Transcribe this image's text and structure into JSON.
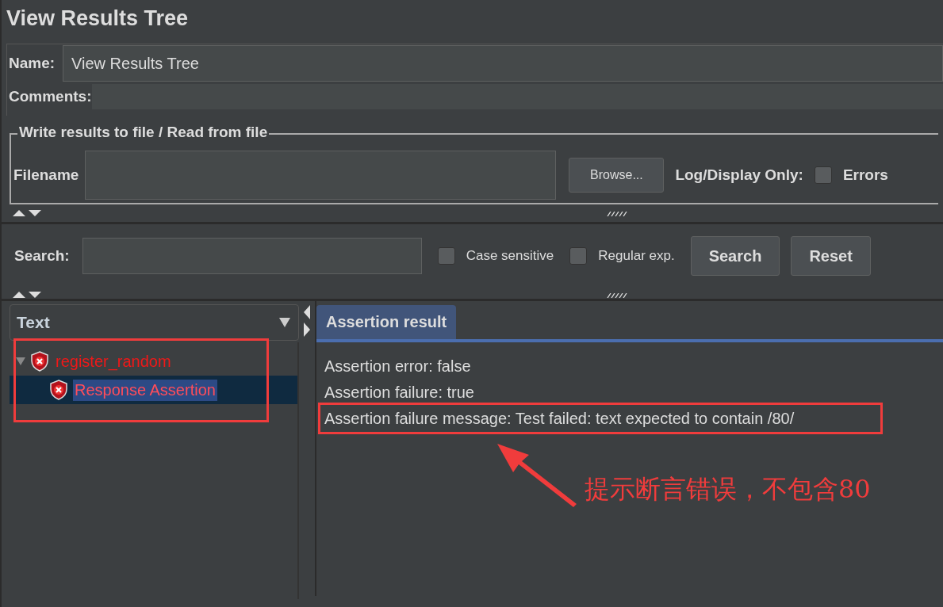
{
  "window": {
    "title": "View Results Tree"
  },
  "name": {
    "label": "Name:",
    "value": "View Results Tree"
  },
  "comments": {
    "label": "Comments:"
  },
  "file_section": {
    "title": "Write results to file / Read from file",
    "filename_label": "Filename",
    "browse_button": "Browse...",
    "log_label": "Log/Display Only:",
    "errors": {
      "label": "Errors",
      "checked": false
    }
  },
  "search": {
    "label": "Search:",
    "options": [
      {
        "label": "Case sensitive",
        "checked": false
      },
      {
        "label": "Regular exp.",
        "checked": false
      }
    ],
    "buttons": [
      "Search",
      "Reset"
    ]
  },
  "tree": {
    "column": "Text",
    "items": [
      {
        "label": "register_random",
        "expanded": true,
        "selected": false,
        "children": [
          {
            "label": "Response Assertion",
            "selected": true
          }
        ]
      }
    ]
  },
  "tabs": [
    {
      "label": "Assertion result",
      "selected": true
    }
  ],
  "result_lines": [
    "Assertion error: false",
    "Assertion failure: true",
    "Assertion failure message: Test failed: text expected to contain /80/"
  ],
  "annotation": {
    "note": "提示断言错误，不包含80"
  }
}
